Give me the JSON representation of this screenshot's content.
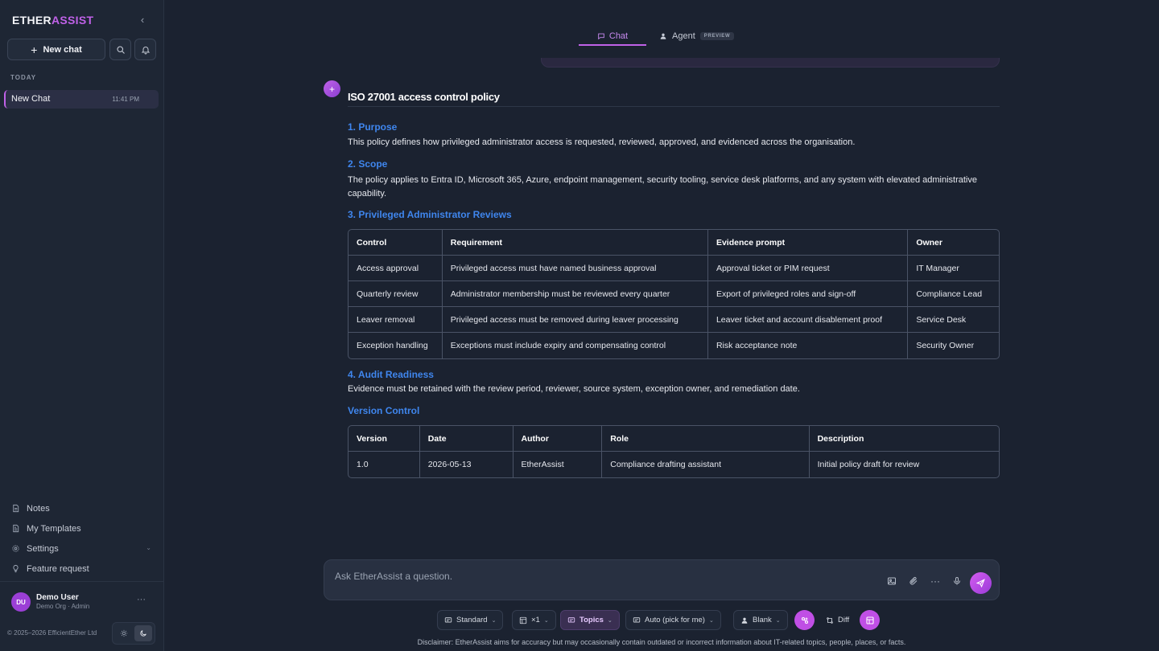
{
  "sidebar": {
    "brand_prefix": "ETHER",
    "brand_accent": "ASSIST",
    "new_chat": "New chat",
    "section_today": "TODAY",
    "chats": [
      {
        "title": "New Chat",
        "time": "11:41 PM"
      }
    ],
    "links": {
      "notes": "Notes",
      "templates": "My Templates",
      "settings": "Settings",
      "feature": "Feature request"
    },
    "user": {
      "initials": "DU",
      "name": "Demo User",
      "role": "Demo Org · Admin"
    },
    "copyright": "© 2025–2026 EfficientEther Ltd"
  },
  "tabs": {
    "chat": "Chat",
    "agent": "Agent",
    "preview_badge": "PREVIEW"
  },
  "message": {
    "title": "ISO 27001 access control policy",
    "s1_heading": "1. Purpose",
    "s1_text": "This policy defines how privileged administrator access is requested, reviewed, approved, and evidenced across the organisation.",
    "s2_heading": "2. Scope",
    "s2_text": "The policy applies to Entra ID, Microsoft 365, Azure, endpoint management, security tooling, service desk platforms, and any system with elevated administrative capability.",
    "s3_heading": "3. Privileged Administrator Reviews",
    "table1": {
      "headers": [
        "Control",
        "Requirement",
        "Evidence prompt",
        "Owner"
      ],
      "rows": [
        [
          "Access approval",
          "Privileged access must have named business approval",
          "Approval ticket or PIM request",
          "IT Manager"
        ],
        [
          "Quarterly review",
          "Administrator membership must be reviewed every quarter",
          "Export of privileged roles and sign-off",
          "Compliance Lead"
        ],
        [
          "Leaver removal",
          "Privileged access must be removed during leaver processing",
          "Leaver ticket and account disablement proof",
          "Service Desk"
        ],
        [
          "Exception handling",
          "Exceptions must include expiry and compensating control",
          "Risk acceptance note",
          "Security Owner"
        ]
      ]
    },
    "s4_heading": "4. Audit Readiness",
    "s4_text": "Evidence must be retained with the review period, reviewer, source system, exception owner, and remediation date.",
    "vc_heading": "Version Control",
    "table2": {
      "headers": [
        "Version",
        "Date",
        "Author",
        "Role",
        "Description"
      ],
      "rows": [
        [
          "1.0",
          "2026-05-13",
          "EtherAssist",
          "Compliance drafting assistant",
          "Initial policy draft for review"
        ]
      ]
    }
  },
  "composer": {
    "placeholder": "Ask EtherAssist a question.",
    "standard": "Standard",
    "multiplier": "×1",
    "topics": "Topics",
    "auto": "Auto (pick for me)",
    "blank": "Blank",
    "diff": "Diff"
  },
  "disclaimer": "Disclaimer: EtherAssist aims for accuracy but may occasionally contain outdated or incorrect information about IT-related topics, people, places, or facts.",
  "colors": {
    "accent": "#c061e8",
    "heading_blue": "#3f86ee",
    "background": "#1b2230"
  }
}
